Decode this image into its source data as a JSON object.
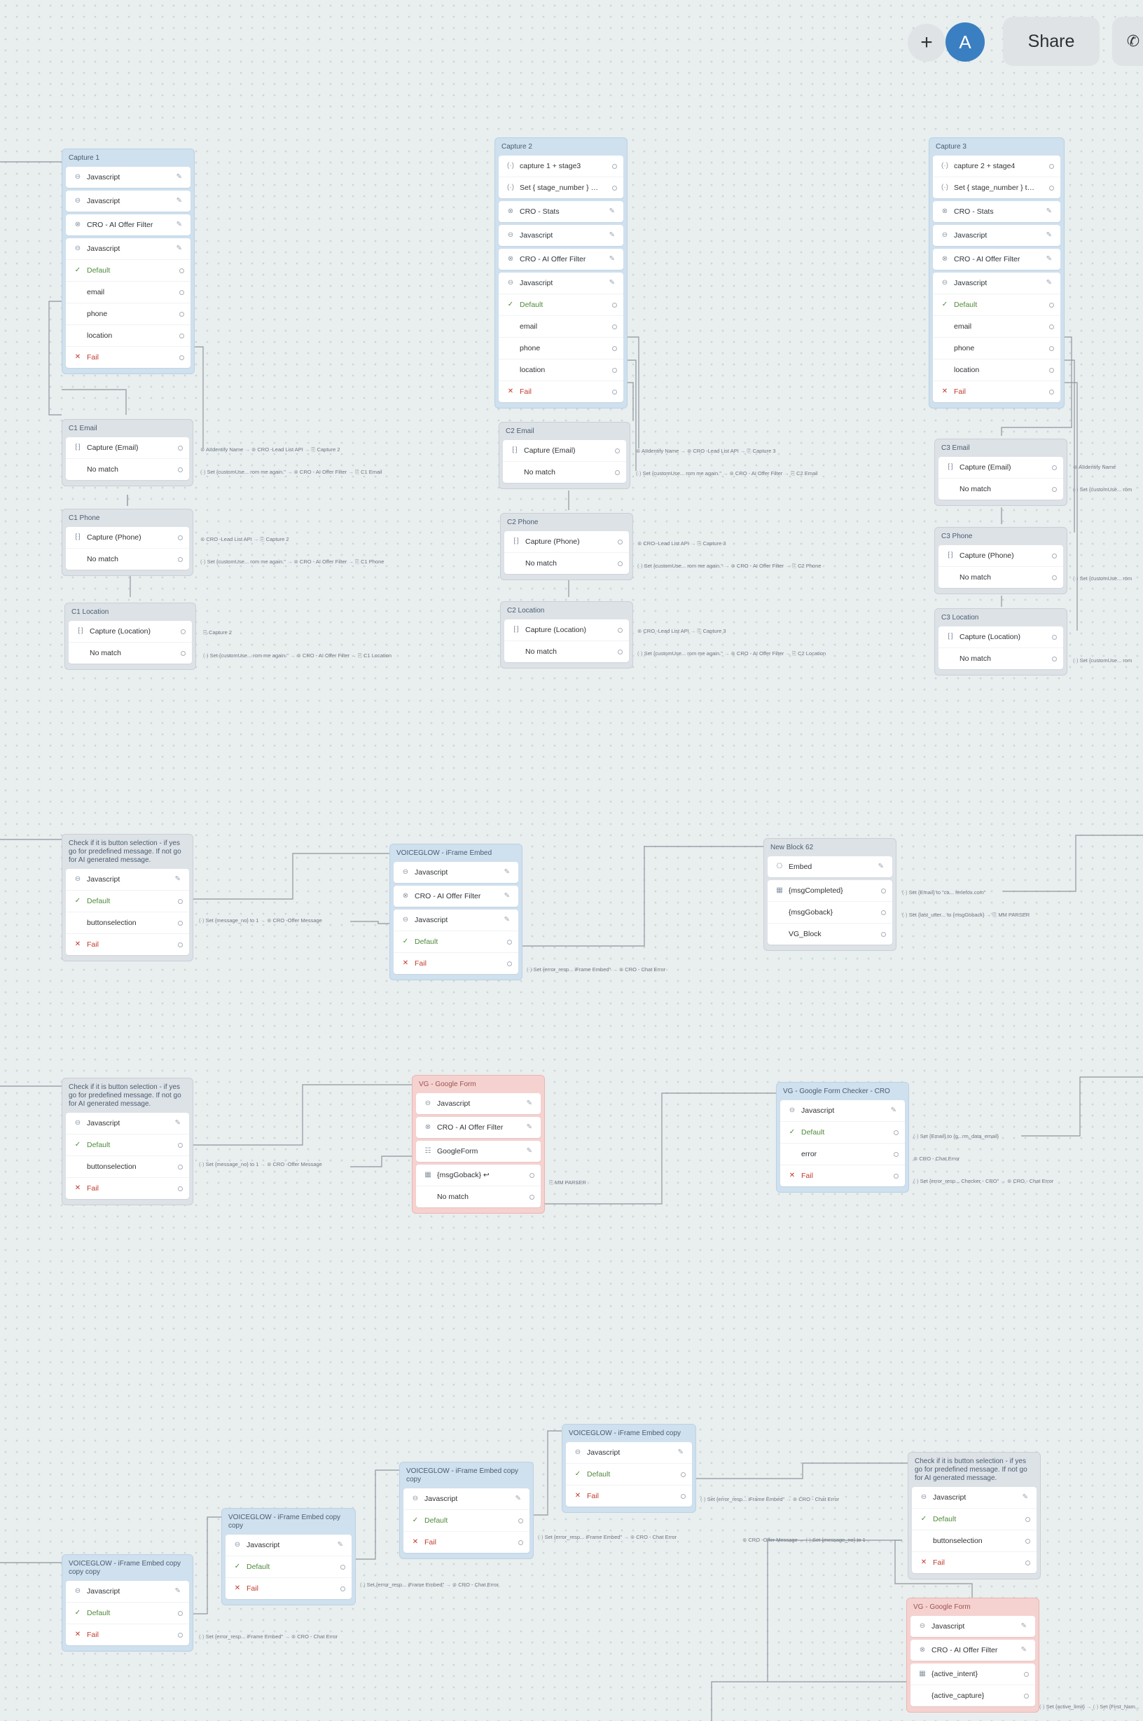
{
  "topbar": {
    "add_symbol": "+",
    "avatar_initial": "A",
    "share_label": "Share",
    "extra_icon": "call-icon"
  },
  "colors": {
    "avatar": "#3a7fc1",
    "blue_block": "#cfe0ee",
    "grey_block": "#dde2e7",
    "red_block": "#f5d2d0",
    "success": "#4f8a3a",
    "fail": "#c0392b"
  },
  "blocks": {
    "capture1": {
      "title": "Capture 1",
      "rows": [
        "Javascript",
        "Javascript",
        "CRO - AI Offer Filter",
        "Javascript",
        "Default",
        "email",
        "phone",
        "location",
        "Fail"
      ]
    },
    "capture2": {
      "title": "Capture 2",
      "rows": [
        "capture 1 + stage3",
        "Set { stage_number } to 3",
        "CRO - Stats",
        "Javascript",
        "CRO - AI Offer Filter",
        "Javascript",
        "Default",
        "email",
        "phone",
        "location",
        "Fail"
      ]
    },
    "capture3": {
      "title": "Capture 3",
      "rows": [
        "capture 2 + stage4",
        "Set { stage_number } to 4",
        "CRO - Stats",
        "Javascript",
        "CRO - AI Offer Filter",
        "Javascript",
        "Default",
        "email",
        "phone",
        "location",
        "Fail"
      ]
    },
    "c1email": {
      "title": "C1 Email",
      "rows": [
        "Capture (Email)",
        "No match"
      ]
    },
    "c1phone": {
      "title": "C1 Phone",
      "rows": [
        "Capture (Phone)",
        "No match"
      ]
    },
    "c1location": {
      "title": "C1 Location",
      "rows": [
        "Capture (Location)",
        "No match"
      ]
    },
    "c2email": {
      "title": "C2 Email",
      "rows": [
        "Capture (Email)",
        "No match"
      ]
    },
    "c2phone": {
      "title": "C2 Phone",
      "rows": [
        "Capture (Phone)",
        "No match"
      ]
    },
    "c2location": {
      "title": "C2 Location",
      "rows": [
        "Capture (Location)",
        "No match"
      ]
    },
    "c3email": {
      "title": "C3 Email",
      "rows": [
        "Capture (Email)",
        "No match"
      ]
    },
    "c3phone": {
      "title": "C3 Phone",
      "rows": [
        "Capture (Phone)",
        "No match"
      ]
    },
    "c3location": {
      "title": "C3 Location",
      "rows": [
        "Capture (Location)",
        "No match"
      ]
    },
    "check1": {
      "title": "Check if it is button selection - if yes go for predefined message. If not go for AI generated message.",
      "rows": [
        "Javascript",
        "Default",
        "buttonselection",
        "Fail"
      ]
    },
    "iframe1": {
      "title": "VOICEGLOW - iFrame Embed",
      "rows": [
        "Javascript",
        "CRO - AI Offer Filter",
        "Javascript",
        "Default",
        "Fail"
      ]
    },
    "newblock62": {
      "title": "New Block 62",
      "rows": [
        "Embed",
        "{msgCompleted}",
        "{msgGoback}",
        "VG_Block"
      ]
    },
    "check2": {
      "title": "Check if it is button selection - if yes go for predefined message. If not go for AI generated message.",
      "rows": [
        "Javascript",
        "Default",
        "buttonselection",
        "Fail"
      ]
    },
    "gform1": {
      "title": "VG - Google Form",
      "rows": [
        "Javascript",
        "CRO - AI Offer Filter",
        "GoogleForm",
        "{msgGoback} ↩",
        "No match"
      ]
    },
    "gformchecker": {
      "title": "VG - Google Form Checker - CRO",
      "rows": [
        "Javascript",
        "Default",
        "error",
        "Fail"
      ]
    },
    "copycopycopy": {
      "title": "VOICEGLOW - iFrame Embed copy copy copy",
      "rows": [
        "Javascript",
        "Default",
        "Fail"
      ]
    },
    "copycopy": {
      "title": "VOICEGLOW - iFrame Embed copy copy",
      "rows": [
        "Javascript",
        "Default",
        "Fail"
      ]
    },
    "copycopy2": {
      "title": "VOICEGLOW - iFrame Embed copy copy",
      "rows": [
        "Javascript",
        "Default",
        "Fail"
      ]
    },
    "copy": {
      "title": "VOICEGLOW - iFrame Embed copy",
      "rows": [
        "Javascript",
        "Default",
        "Fail"
      ]
    },
    "check3": {
      "title": "Check if it is button selection - if yes go for predefined message. If not go for AI generated message.",
      "rows": [
        "Javascript",
        "Default",
        "buttonselection",
        "Fail"
      ]
    },
    "gform2": {
      "title": "VG - Google Form",
      "rows": [
        "Javascript",
        "CRO - AI Offer Filter",
        "{active_intent}",
        "{active_capture}"
      ],
      "sub": "{active_capture}"
    }
  },
  "chains": [
    {
      "id": "c1e1",
      "items": [
        "AIIdentify Name",
        "CRO -Lead List API",
        "Capture 2"
      ]
    },
    {
      "id": "c1e2",
      "items": [
        "Set {customUse... rom me again.\"",
        "CRO - AI Offer Filter",
        "C1 Email"
      ]
    },
    {
      "id": "c1p1",
      "items": [
        "CRO -Lead List API",
        "Capture 2"
      ]
    },
    {
      "id": "c1p2",
      "items": [
        "Set {customUse... rom me again.\"",
        "CRO - AI Offer Filter",
        "C1 Phone"
      ]
    },
    {
      "id": "c1l1",
      "items": [
        "Capture 2"
      ]
    },
    {
      "id": "c1l2",
      "items": [
        "Set {customUse... rom me again.\"",
        "CRO - AI Offer Filter",
        "C1 Location"
      ]
    },
    {
      "id": "c2e1",
      "items": [
        "AIIdentify Name",
        "CRO -Lead List API",
        "Capture 3"
      ]
    },
    {
      "id": "c2e2",
      "items": [
        "Set {customUse... rom me again.\"",
        "CRO - AI Offer Filter",
        "C2 Email"
      ]
    },
    {
      "id": "c2p1",
      "items": [
        "CRO -Lead List API",
        "Capture 3"
      ]
    },
    {
      "id": "c2p2",
      "items": [
        "Set {customUse... rom me again.\"",
        "CRO - AI Offer Filter",
        "C2 Phone"
      ]
    },
    {
      "id": "c2l1",
      "items": [
        "CRO -Lead List API",
        "Capture 3"
      ]
    },
    {
      "id": "c2l2",
      "items": [
        "Set {customUse... rom me again.\"",
        "CRO - AI Offer Filter",
        "C2 Location"
      ]
    },
    {
      "id": "c3e1",
      "items": [
        "AIIdentify Name"
      ]
    },
    {
      "id": "c3e2",
      "items": [
        "Set {customUse... rom"
      ]
    },
    {
      "id": "c3p2",
      "items": [
        "Set {customUse... rom"
      ]
    },
    {
      "id": "c3l2",
      "items": [
        "Set {customUse... rom"
      ]
    },
    {
      "id": "k1",
      "items": [
        "Set {message_no} to 1",
        "CRO -Offer Message"
      ]
    },
    {
      "id": "if1",
      "items": [
        "Set {error_resp... iFrame Embed\"",
        "CRO - Chat Error"
      ]
    },
    {
      "id": "nb1",
      "items": [
        "Set {Email} to \"ca... ferlefox.com\""
      ]
    },
    {
      "id": "nb2",
      "items": [
        "Set {last_utter... to {msgGoback}",
        "MM PARSER"
      ]
    },
    {
      "id": "k2",
      "items": [
        "Set {message_no} to 1",
        "CRO -Offer Message"
      ]
    },
    {
      "id": "gf1",
      "items": [
        "MM PARSER"
      ]
    },
    {
      "id": "gc1",
      "items": [
        "Set {Email} to {g...rm_data_email}"
      ]
    },
    {
      "id": "gc2",
      "items": [
        "CRO - Chat Error"
      ]
    },
    {
      "id": "gc3",
      "items": [
        "Set {error_resp... Checker - CRO\"",
        "CRO - Chat Error"
      ]
    },
    {
      "id": "ccc",
      "items": [
        "Set {error_resp... iFrame Embed\"",
        "CRO - Chat Error"
      ]
    },
    {
      "id": "cc1",
      "items": [
        "Set {error_resp... iFrame Embed\"",
        "CRO - Chat Error"
      ]
    },
    {
      "id": "cc2",
      "items": [
        "Set {error_resp... iFrame Embed\"",
        "CRO - Chat Error"
      ]
    },
    {
      "id": "cp1",
      "items": [
        "Set {error_resp... iFrame Embed\"",
        "CRO - Chat Error"
      ]
    },
    {
      "id": "k3",
      "items": [
        "CRO -Offer Message",
        "Set {message_no} to 1"
      ]
    },
    {
      "id": "gf2",
      "items": [
        "Set {active_limit}",
        "Set {First_Nam..."
      ]
    }
  ]
}
